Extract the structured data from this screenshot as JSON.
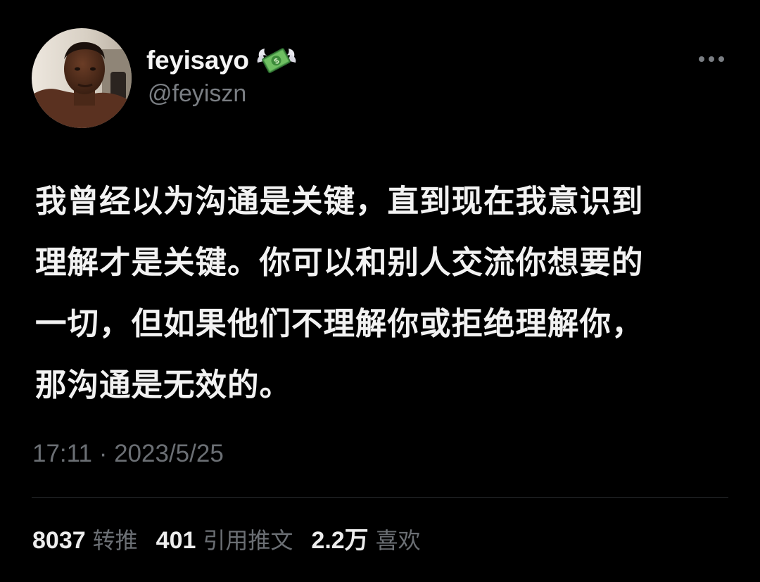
{
  "author": {
    "display_name": "feyisayo",
    "badge_emoji_icon": "money-with-wings-icon",
    "handle": "@feyiszn"
  },
  "tweet": {
    "text_lines": [
      "我曾经以为沟通是关键，直到现在我意识到",
      "理解才是关键。你可以和别人交流你想要的",
      "一切，但如果他们不理解你或拒绝理解你，",
      "那沟通是无效的。"
    ],
    "timestamp": "17:11 · 2023/5/25"
  },
  "stats": {
    "retweets": {
      "count": "8037",
      "label": "转推"
    },
    "quotes": {
      "count": "401",
      "label": "引用推文"
    },
    "likes": {
      "count": "2.2万",
      "label": "喜欢"
    }
  },
  "colors": {
    "background": "#000000",
    "text_primary": "#f2f2f2",
    "text_secondary": "#6b6f74",
    "divider": "#2a2d30"
  },
  "icons": {
    "more": "more-horizontal-icon",
    "avatar": "avatar"
  }
}
